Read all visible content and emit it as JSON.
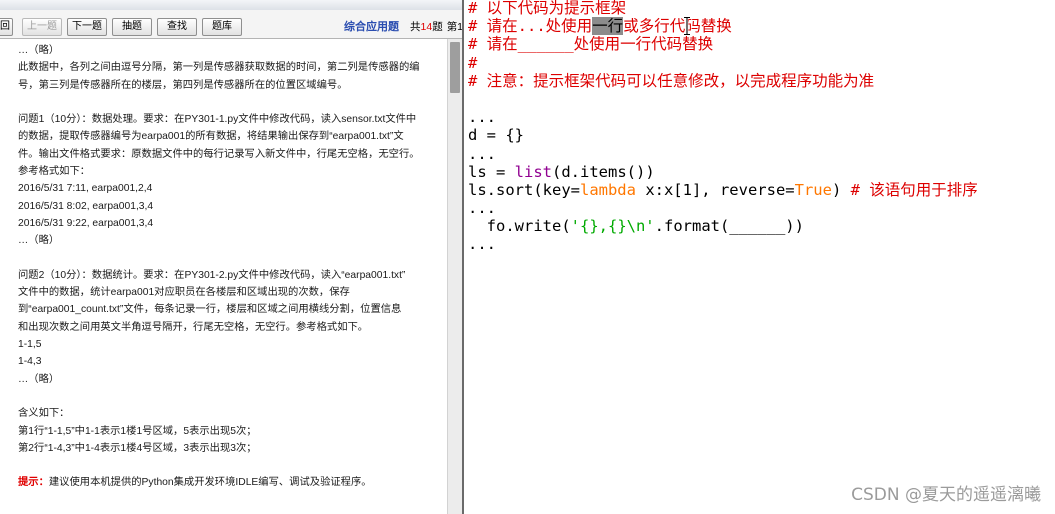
{
  "exam": {
    "toolbar": {
      "buttons": [
        {
          "label": "回",
          "enabled": true
        },
        {
          "label": "上一题",
          "enabled": false
        },
        {
          "label": "下一题",
          "enabled": true
        },
        {
          "label": "抽题",
          "enabled": true
        },
        {
          "label": "查找",
          "enabled": true
        },
        {
          "label": "题库",
          "enabled": true
        }
      ],
      "question_type": "综合应用题",
      "count_prefix": "共",
      "count": "14",
      "count_suffix": "题",
      "current": "第1"
    },
    "intro": [
      "…（略）",
      "此数据中，各列之间由逗号分隔，第一列是传感器获取数据的时间，第二列是传感器的编",
      "号，第三列是传感器所在的楼层，第四列是传感器所在的位置区域编号。"
    ],
    "question1": [
      "问题1（10分）：数据处理。要求：在PY301-1.py文件中修改代码，读入sensor.txt文件中",
      "的数据，提取传感器编号为earpa001的所有数据，将结果输出保存到“earpa001.txt”文",
      "件。输出文件格式要求：原数据文件中的每行记录写入新文件中，行尾无空格，无空行。",
      "参考格式如下：",
      "2016/5/31 7:11, earpa001,2,4",
      "2016/5/31 8:02, earpa001,3,4",
      "2016/5/31 9:22, earpa001,3,4",
      "…（略）"
    ],
    "question2": [
      "问题2（10分）：数据统计。要求：在PY301-2.py文件中修改代码，读入“earpa001.txt”",
      "文件中的数据，统计earpa001对应职员在各楼层和区域出现的次数，保存",
      "到“earpa001_count.txt”文件，每条记录一行，楼层和区域之间用横线分割，位置信息",
      "和出现次数之间用英文半角逗号隔开，行尾无空格，无空行。参考格式如下。",
      "1-1,5",
      "1-4,3",
      "…（略）"
    ],
    "meaning": [
      "含义如下：",
      "第1行“1-1,5”中1-1表示1楼1号区域，5表示出现5次；",
      "第2行“1-4,3”中1-4表示1楼4号区域，3表示出现3次；"
    ],
    "hint": {
      "label": "提示：",
      "text": "建议使用本机提供的Python集成开发环境IDLE编写、调试及验证程序。"
    }
  },
  "editor": {
    "lines": [
      [
        {
          "text": "# 以下代码为提示框架",
          "color": "#dd0000"
        }
      ],
      [
        {
          "text": "# 请在...处使用",
          "color": "#dd0000"
        },
        {
          "text": "一行",
          "color": "#000000",
          "highlight": "#8c8c8c"
        },
        {
          "text": "或多行代码替换",
          "color": "#dd0000"
        }
      ],
      [
        {
          "text": "# 请在______处使用一行代码替换",
          "color": "#dd0000"
        }
      ],
      [
        {
          "text": "#",
          "color": "#dd0000"
        }
      ],
      [
        {
          "text": "# 注意：提示框架代码可以任意修改，以完成程序功能为准",
          "color": "#dd0000"
        }
      ],
      [
        {
          "text": "...",
          "color": "#000000"
        }
      ],
      [
        {
          "text": "d = {}",
          "color": "#000000"
        }
      ],
      [
        {
          "text": "...",
          "color": "#000000"
        }
      ],
      [
        {
          "text": "ls = ",
          "color": "#000000"
        },
        {
          "text": "list",
          "color": "#900090"
        },
        {
          "text": "(d.items())",
          "color": "#000000"
        }
      ],
      [
        {
          "text": "ls.sort(key=",
          "color": "#000000"
        },
        {
          "text": "lambda",
          "color": "#ff7700"
        },
        {
          "text": " x:x[1], reverse=",
          "color": "#000000"
        },
        {
          "text": "True",
          "color": "#ff7700"
        },
        {
          "text": ") ",
          "color": "#000000"
        },
        {
          "text": "# 该语句用于排序",
          "color": "#dd0000"
        }
      ],
      [
        {
          "text": "...",
          "color": "#000000"
        }
      ],
      [
        {
          "text": "  fo.write(",
          "color": "#000000"
        },
        {
          "text": "'{},{}\\n'",
          "color": "#00aa00"
        },
        {
          "text": ".format(______))",
          "color": "#000000"
        }
      ],
      [
        {
          "text": "...",
          "color": "#000000"
        }
      ]
    ]
  },
  "watermark": "CSDN @夏天的遥遥漓曦",
  "colors": {
    "question_type": "#2a4db0",
    "count_number": "#e00000",
    "hint_label": "#e00000",
    "watermark": "#9b9b9b"
  },
  "icons": {
    "mouse_cursor": "text-cursor-icon"
  }
}
